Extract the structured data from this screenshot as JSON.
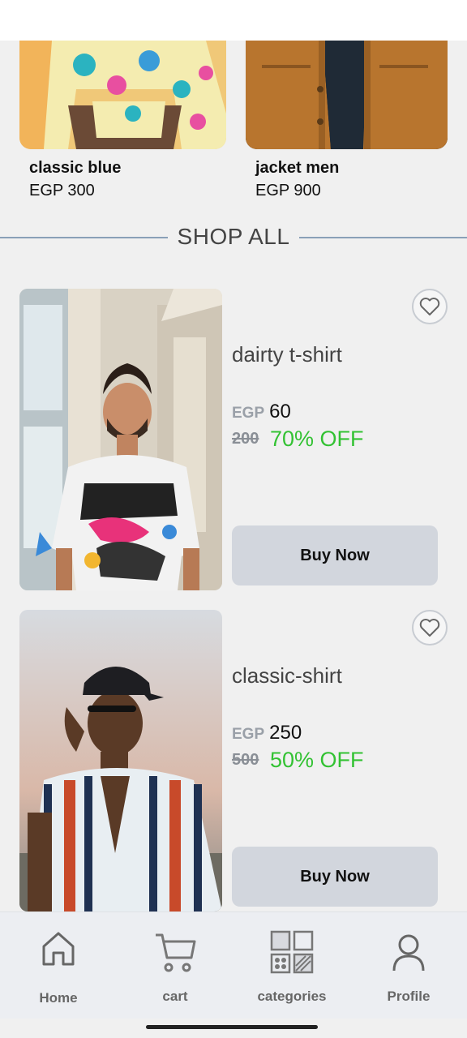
{
  "featured": [
    {
      "name": "classic blue",
      "price": "EGP 300"
    },
    {
      "name": "jacket men",
      "price": "EGP 900"
    }
  ],
  "section": {
    "title": "SHOP ALL"
  },
  "products": [
    {
      "name": "dairty t-shirt",
      "currency": "EGP",
      "price": "60",
      "old_price": "200",
      "discount": "70% OFF",
      "buy_label": "Buy Now"
    },
    {
      "name": "classic-shirt",
      "currency": "EGP",
      "price": "250",
      "old_price": "500",
      "discount": "50% OFF",
      "buy_label": "Buy Now"
    }
  ],
  "nav": [
    {
      "label": "Home",
      "icon": "home-icon"
    },
    {
      "label": "cart",
      "icon": "cart-icon"
    },
    {
      "label": "categories",
      "icon": "categories-icon"
    },
    {
      "label": "Profile",
      "icon": "profile-icon"
    }
  ],
  "colors": {
    "discount": "#33c233",
    "button": "#d2d6dd",
    "divider": "#8aa0b8"
  }
}
